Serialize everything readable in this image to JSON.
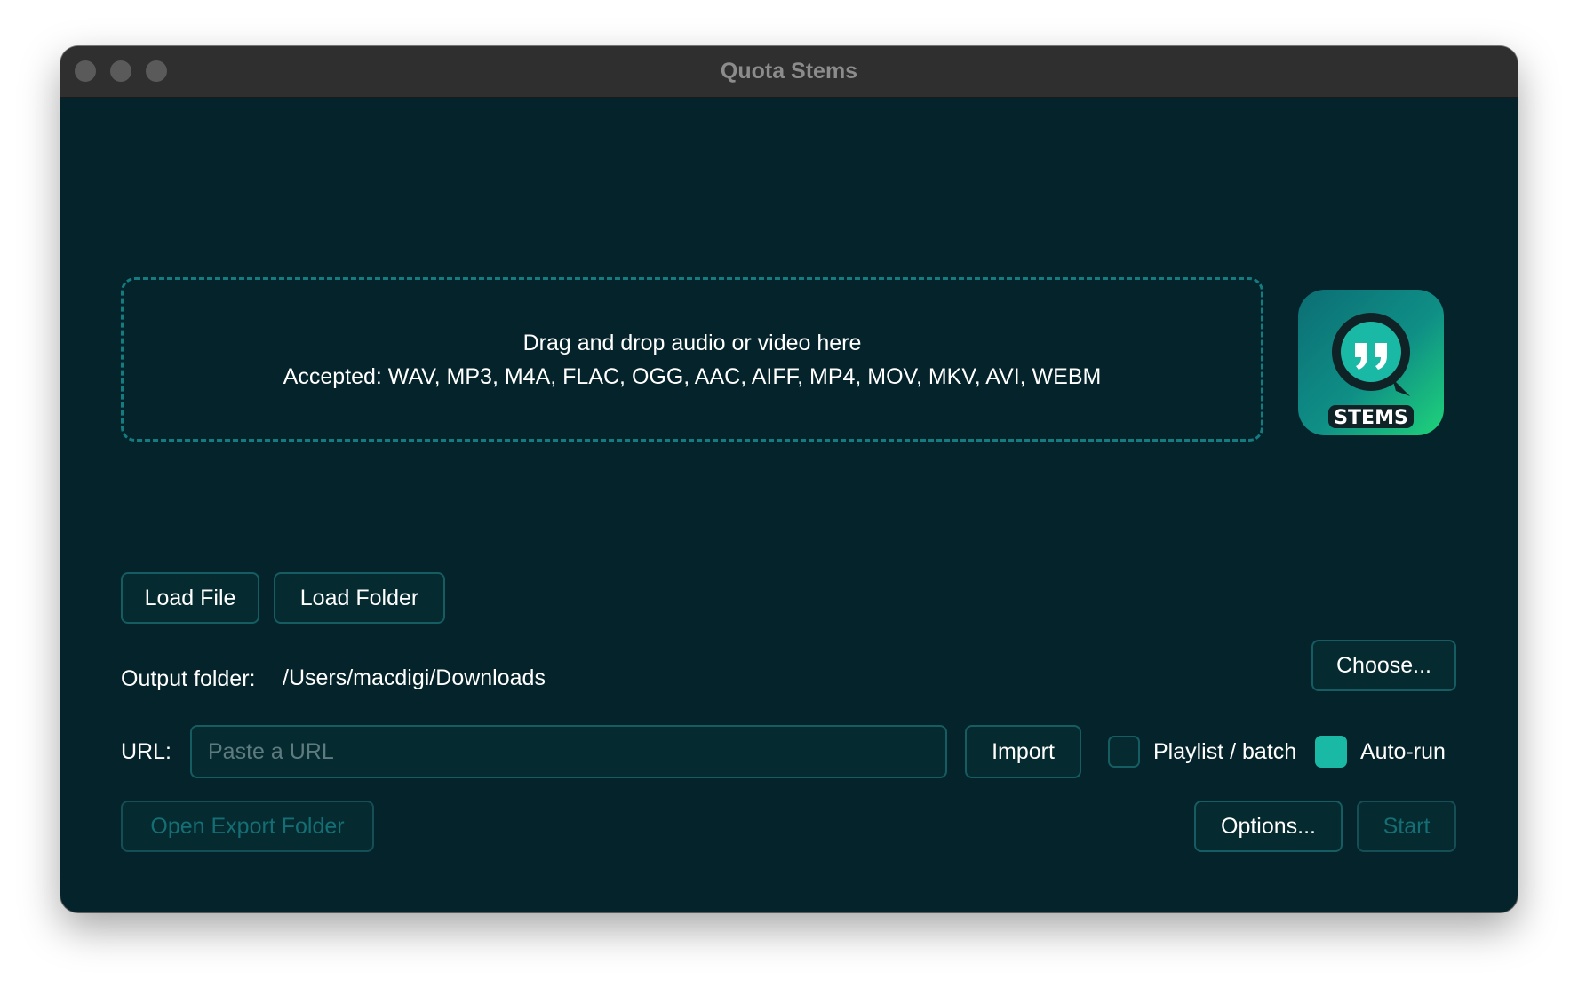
{
  "window": {
    "title": "Quota Stems"
  },
  "dropzone": {
    "line1": "Drag and drop audio or video here",
    "line2": "Accepted: WAV, MP3, M4A, FLAC, OGG, AAC, AIFF, MP4, MOV, MKV, AVI, WEBM"
  },
  "logo": {
    "text": "STEMS",
    "icon": "quote-bubble-icon"
  },
  "buttons": {
    "load_file": "Load File",
    "load_folder": "Load Folder",
    "choose": "Choose...",
    "import": "Import",
    "open_export": "Open Export Folder",
    "options": "Options...",
    "start": "Start"
  },
  "output": {
    "label": "Output folder:",
    "path": "/Users/macdigi/Downloads"
  },
  "url": {
    "label": "URL:",
    "placeholder": "Paste a URL",
    "value": ""
  },
  "toggles": {
    "playlist_label": "Playlist / batch",
    "playlist_checked": false,
    "autorun_label": "Auto-run",
    "autorun_checked": true
  },
  "colors": {
    "background": "#05232a",
    "accent": "#1ab9a5",
    "border": "#155d63",
    "titlebar": "#2f2f2f"
  }
}
